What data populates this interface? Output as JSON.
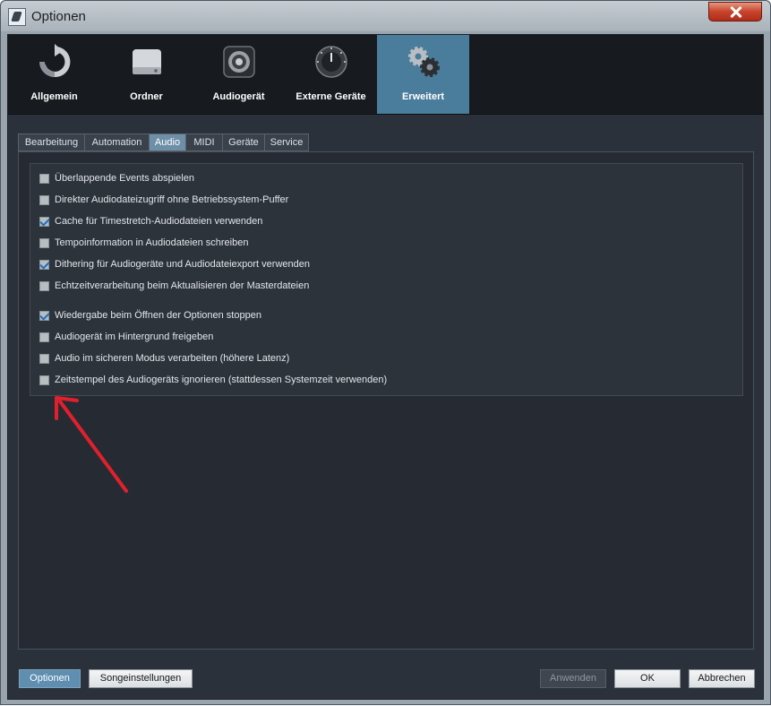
{
  "window": {
    "title": "Optionen",
    "accent": "#4a7c9b"
  },
  "topnav": {
    "items": [
      {
        "label": "Allgemein",
        "icon": "refresh-icon"
      },
      {
        "label": "Ordner",
        "icon": "drive-icon"
      },
      {
        "label": "Audiogerät",
        "icon": "speaker-icon"
      },
      {
        "label": "Externe Geräte",
        "icon": "knob-icon"
      },
      {
        "label": "Erweitert",
        "icon": "gears-icon",
        "active": true
      }
    ]
  },
  "tabs": [
    "Bearbeitung",
    "Automation",
    "Audio",
    "MIDI",
    "Geräte",
    "Service"
  ],
  "active_tab": "Audio",
  "options": [
    {
      "label": "Überlappende Events abspielen",
      "checked": false
    },
    {
      "label": "Direkter Audiodateizugriff ohne Betriebssystem-Puffer",
      "checked": false
    },
    {
      "label": "Cache für Timestretch-Audiodateien verwenden",
      "checked": true
    },
    {
      "label": "Tempoinformation in Audiodateien schreiben",
      "checked": false
    },
    {
      "label": "Dithering für Audiogeräte und Audiodateiexport verwenden",
      "checked": true
    },
    {
      "label": "Echtzeitverarbeitung beim Aktualisieren der Masterdateien",
      "checked": false
    },
    {
      "label": "Wiedergabe beim Öffnen der Optionen stoppen",
      "checked": true
    },
    {
      "label": "Audiogerät im Hintergrund freigeben",
      "checked": false
    },
    {
      "label": "Audio im sicheren Modus verarbeiten (höhere Latenz)",
      "checked": false
    },
    {
      "label": "Zeitstempel des Audiogeräts ignorieren (stattdessen Systemzeit verwenden)",
      "checked": false
    }
  ],
  "annotation": {
    "color": "#e0202c"
  },
  "footer": {
    "optionen": "Optionen",
    "songeinstellungen": "Songeinstellungen",
    "anwenden": "Anwenden",
    "ok": "OK",
    "abbrechen": "Abbrechen"
  }
}
